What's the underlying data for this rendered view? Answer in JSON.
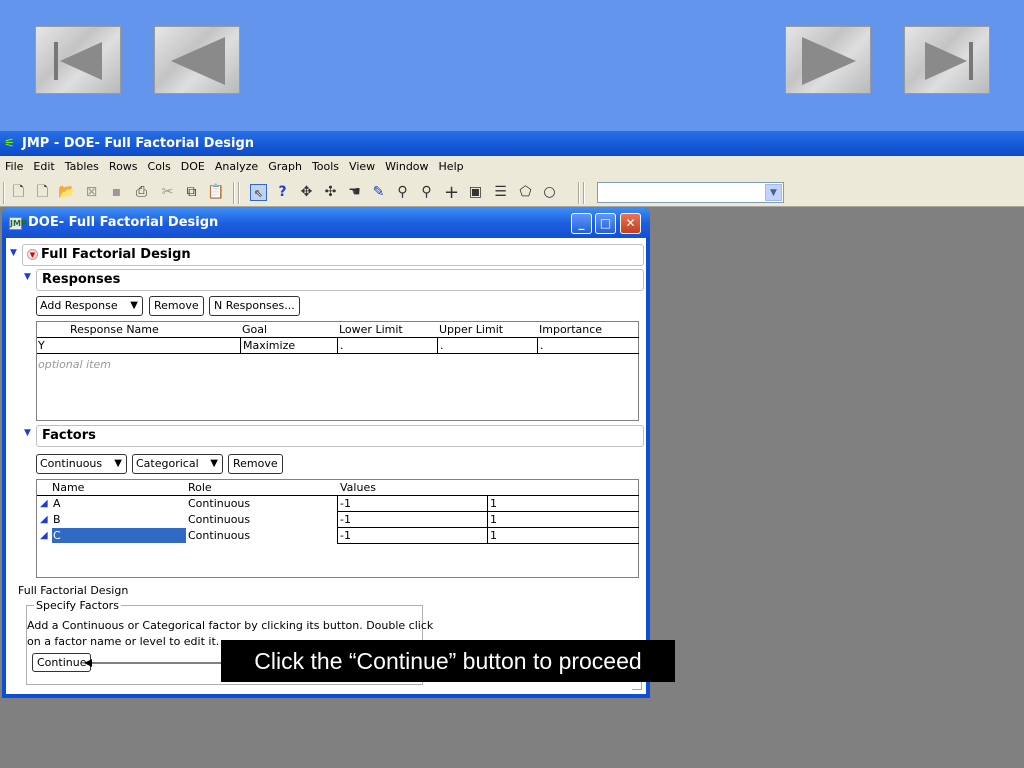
{
  "app": {
    "title": "JMP - DOE- Full Factorial Design",
    "menu": [
      "File",
      "Edit",
      "Tables",
      "Rows",
      "Cols",
      "DOE",
      "Analyze",
      "Graph",
      "Tools",
      "View",
      "Window",
      "Help"
    ]
  },
  "window": {
    "title": "DOE- Full Factorial Design"
  },
  "outline": {
    "main_title": "Full Factorial Design",
    "responses_title": "Responses",
    "factors_title": "Factors"
  },
  "responses": {
    "add_response": "Add Response",
    "remove": "Remove",
    "n_responses": "N Responses...",
    "headers": [
      "Response Name",
      "Goal",
      "Lower Limit",
      "Upper Limit",
      "Importance"
    ],
    "row": {
      "name": "Y",
      "goal": "Maximize",
      "lower": ".",
      "upper": ".",
      "importance": "."
    },
    "optional": "optional item"
  },
  "factors": {
    "continuous": "Continuous",
    "categorical": "Categorical",
    "remove": "Remove",
    "headers": [
      "Name",
      "Role",
      "Values"
    ],
    "rows": [
      {
        "name": "A",
        "role": "Continuous",
        "low": "-1",
        "high": "1"
      },
      {
        "name": "B",
        "role": "Continuous",
        "low": "-1",
        "high": "1"
      },
      {
        "name": "C",
        "role": "Continuous",
        "low": "-1",
        "high": "1"
      }
    ]
  },
  "status": {
    "heading": "Full Factorial Design",
    "group_label": "Specify Factors",
    "instructions_line1": "Add a Continuous or Categorical factor by clicking its button. Double click",
    "instructions_line2": "on a factor name or level to edit it.",
    "continue": "Continue"
  },
  "callout": "Click the “Continue” button to proceed",
  "colors": {
    "slide_bg": "#6495ed",
    "desktop": "#808080",
    "titlebar": "#1458d8",
    "selection": "#316ac5"
  }
}
